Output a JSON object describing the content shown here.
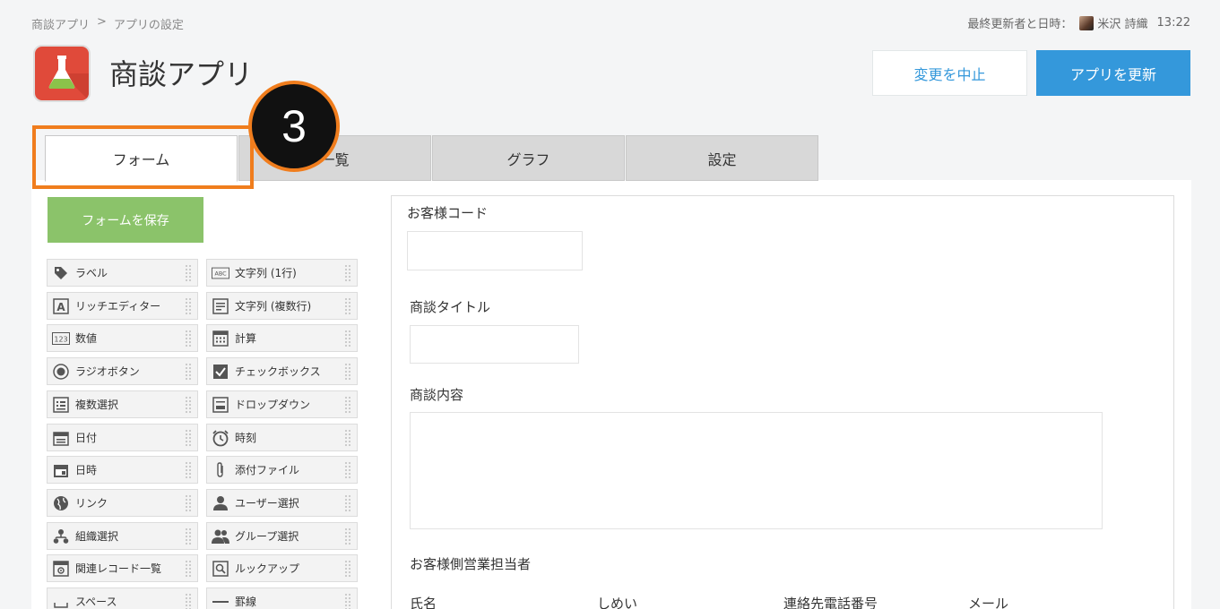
{
  "breadcrumb": {
    "app": "商談アプリ",
    "separator": ">",
    "current": "アプリの設定"
  },
  "updated": {
    "label": "最終更新者と日時：",
    "user": "米沢 詩織",
    "time": "13:22"
  },
  "app": {
    "title": "商談アプリ",
    "icon": "flask-icon",
    "icon_color": "#e04a3a"
  },
  "actions": {
    "cancel_label": "変更を中止",
    "update_label": "アプリを更新"
  },
  "tabs": [
    {
      "label": "フォーム",
      "active": true
    },
    {
      "label": "一覧",
      "active": false
    },
    {
      "label": "グラフ",
      "active": false
    },
    {
      "label": "設定",
      "active": false
    }
  ],
  "annotation": {
    "step_number": "3",
    "color": "#f07d1d"
  },
  "save_form_label": "フォームを保存",
  "palette": {
    "left": [
      {
        "label": "ラベル",
        "icon": "tag-icon"
      },
      {
        "label": "リッチエディター",
        "icon": "rich-editor-icon"
      },
      {
        "label": "数値",
        "icon": "number-icon"
      },
      {
        "label": "ラジオボタン",
        "icon": "radio-icon"
      },
      {
        "label": "複数選択",
        "icon": "multi-select-icon"
      },
      {
        "label": "日付",
        "icon": "date-icon"
      },
      {
        "label": "日時",
        "icon": "datetime-icon"
      },
      {
        "label": "リンク",
        "icon": "globe-icon"
      },
      {
        "label": "組織選択",
        "icon": "org-icon"
      },
      {
        "label": "関連レコード一覧",
        "icon": "related-records-icon"
      },
      {
        "label": "スペース",
        "icon": "space-icon"
      }
    ],
    "right": [
      {
        "label": "文字列 (1行)",
        "icon": "text-line-icon"
      },
      {
        "label": "文字列 (複数行)",
        "icon": "text-multiline-icon"
      },
      {
        "label": "計算",
        "icon": "calculator-icon"
      },
      {
        "label": "チェックボックス",
        "icon": "checkbox-icon"
      },
      {
        "label": "ドロップダウン",
        "icon": "dropdown-icon"
      },
      {
        "label": "時刻",
        "icon": "clock-icon"
      },
      {
        "label": "添付ファイル",
        "icon": "paperclip-icon"
      },
      {
        "label": "ユーザー選択",
        "icon": "user-icon"
      },
      {
        "label": "グループ選択",
        "icon": "group-icon"
      },
      {
        "label": "ルックアップ",
        "icon": "lookup-icon"
      },
      {
        "label": "罫線",
        "icon": "line-icon"
      }
    ]
  },
  "form": {
    "customer_code_label": "お客様コード",
    "deal_title_label": "商談タイトル",
    "deal_content_label": "商談内容",
    "contact_group_label": "お客様側営業担当者",
    "contact_columns": [
      "氏名",
      "しめい",
      "連絡先電話番号",
      "メール"
    ]
  },
  "colors": {
    "accent": "#3498db",
    "save": "#8bc36a"
  }
}
